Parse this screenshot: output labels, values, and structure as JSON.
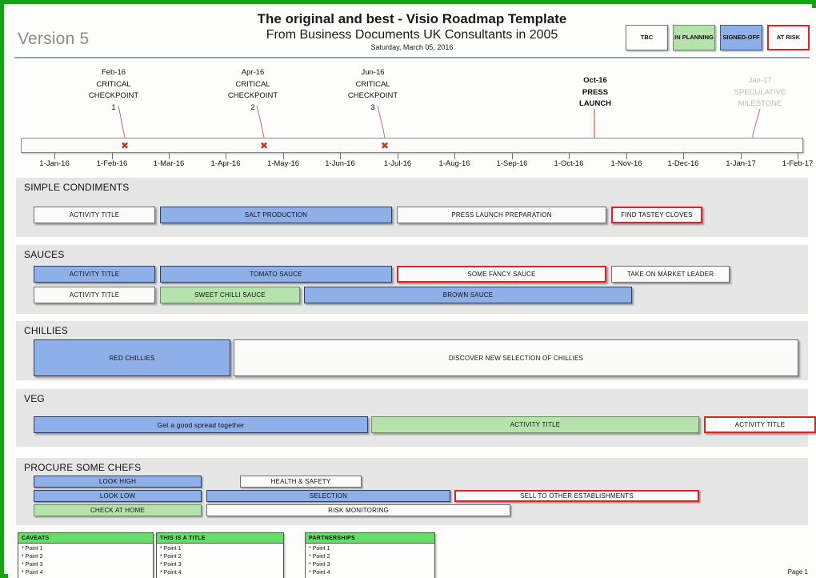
{
  "header": {
    "version": "Version 5",
    "title_line1": "The original and best - Visio Roadmap Template",
    "title_line2": "From Business Documents UK Consultants in 2005",
    "date": "Saturday, March 05, 2016",
    "legend": [
      {
        "label": "TBC",
        "style": "white"
      },
      {
        "label": "IN PLANNING",
        "style": "green"
      },
      {
        "label": "SIGNED-OFF",
        "style": "blue"
      },
      {
        "label": "AT RISK",
        "style": "risk"
      }
    ]
  },
  "timeline": {
    "ticks": [
      "1-Jan-16",
      "1-Feb-16",
      "1-Mar-16",
      "1-Apr-16",
      "1-May-16",
      "1-Jun-16",
      "1-Jul-16",
      "1-Aug-16",
      "1-Sep-16",
      "1-Oct-16",
      "1-Nov-16",
      "1-Dec-16",
      "1-Jan-17",
      "1-Feb-17"
    ],
    "milestones": [
      {
        "date": "Feb-16",
        "name_line1": "CRITICAL",
        "name_line2": "CHECKPOINT",
        "name_line3": "1",
        "marker": "x",
        "style": "normal"
      },
      {
        "date": "Apr-16",
        "name_line1": "CRITICAL",
        "name_line2": "CHECKPOINT",
        "name_line3": "2",
        "marker": "x",
        "style": "normal"
      },
      {
        "date": "Jun-16",
        "name_line1": "CRITICAL",
        "name_line2": "CHECKPOINT",
        "name_line3": "3",
        "marker": "x",
        "style": "normal"
      },
      {
        "date": "Oct-16",
        "name_line1": "PRESS",
        "name_line2": "LAUNCH",
        "name_line3": "",
        "marker": "arrow",
        "style": "bold"
      },
      {
        "date": "Jan-17",
        "name_line1": "SPECULATIVE",
        "name_line2": "MILESTONE",
        "name_line3": "",
        "marker": "arrow",
        "style": "ghost"
      }
    ]
  },
  "lanes": [
    {
      "title": "SIMPLE CONDIMENTS",
      "bars": [
        {
          "label": "ACTIVITY TITLE",
          "style": "white"
        },
        {
          "label": "SALT PRODUCTION",
          "style": "blue"
        },
        {
          "label": "PRESS LAUNCH PREPARATION",
          "style": "white"
        },
        {
          "label": "FIND TASTEY CLOVES",
          "style": "risk"
        }
      ]
    },
    {
      "title": "SAUCES",
      "bars": [
        {
          "label": "ACTIVITY TITLE",
          "style": "blue"
        },
        {
          "label": "TOMATO SAUCE",
          "style": "blue"
        },
        {
          "label": "SOME FANCY SAUCE",
          "style": "risk"
        },
        {
          "label": "TAKE ON MARKET LEADER",
          "style": "white"
        },
        {
          "label": "ACTIVITY TITLE",
          "style": "white"
        },
        {
          "label": "SWEET CHILLI SAUCE",
          "style": "green"
        },
        {
          "label": "BROWN SAUCE",
          "style": "blue"
        }
      ]
    },
    {
      "title": "CHILLIES",
      "bars": [
        {
          "label": "RED CHILLIES",
          "style": "blue"
        },
        {
          "label": "DISCOVER NEW SELECTION OF CHILLIES",
          "style": "white"
        }
      ]
    },
    {
      "title": "VEG",
      "bars": [
        {
          "label": "Get a good spread together",
          "style": "blue"
        },
        {
          "label": "ACTIVITY TITLE",
          "style": "green"
        },
        {
          "label": "ACTIVITY TITLE",
          "style": "risk"
        }
      ]
    },
    {
      "title": "PROCURE SOME CHEFS",
      "bars": [
        {
          "label": "LOOK HIGH",
          "style": "blue"
        },
        {
          "label": "HEALTH & SAFETY",
          "style": "white"
        },
        {
          "label": "LOOK LOW",
          "style": "blue"
        },
        {
          "label": "SELECTION",
          "style": "blue"
        },
        {
          "label": "SELL TO OTHER ESTABLISHMENTS",
          "style": "risk"
        },
        {
          "label": "CHECK AT HOME",
          "style": "green"
        },
        {
          "label": "RISK MONITORING",
          "style": "white"
        }
      ]
    }
  ],
  "notes": [
    {
      "title": "CAVEATS",
      "points": [
        "* Point 1",
        "* Point 2",
        "* Point 3",
        "* Point 4"
      ]
    },
    {
      "title": "THIS IS A TITLE",
      "points": [
        "* Point 1",
        "* Point 2",
        "* Point 3",
        "* Point 4"
      ]
    },
    {
      "title": "PARTNERSHIPS",
      "points": [
        "* Point 1",
        "* Point 2",
        "* Point 3",
        "* Point 4"
      ]
    }
  ],
  "footer": {
    "page": "Page 1"
  },
  "colors": {
    "border_green": "#13A313",
    "bar_blue": "#8FAFE8",
    "bar_green": "#B6E3AC",
    "risk_red": "#EC1C24",
    "lane_grey": "#E6E6E6",
    "note_header_green": "#66DD66"
  }
}
